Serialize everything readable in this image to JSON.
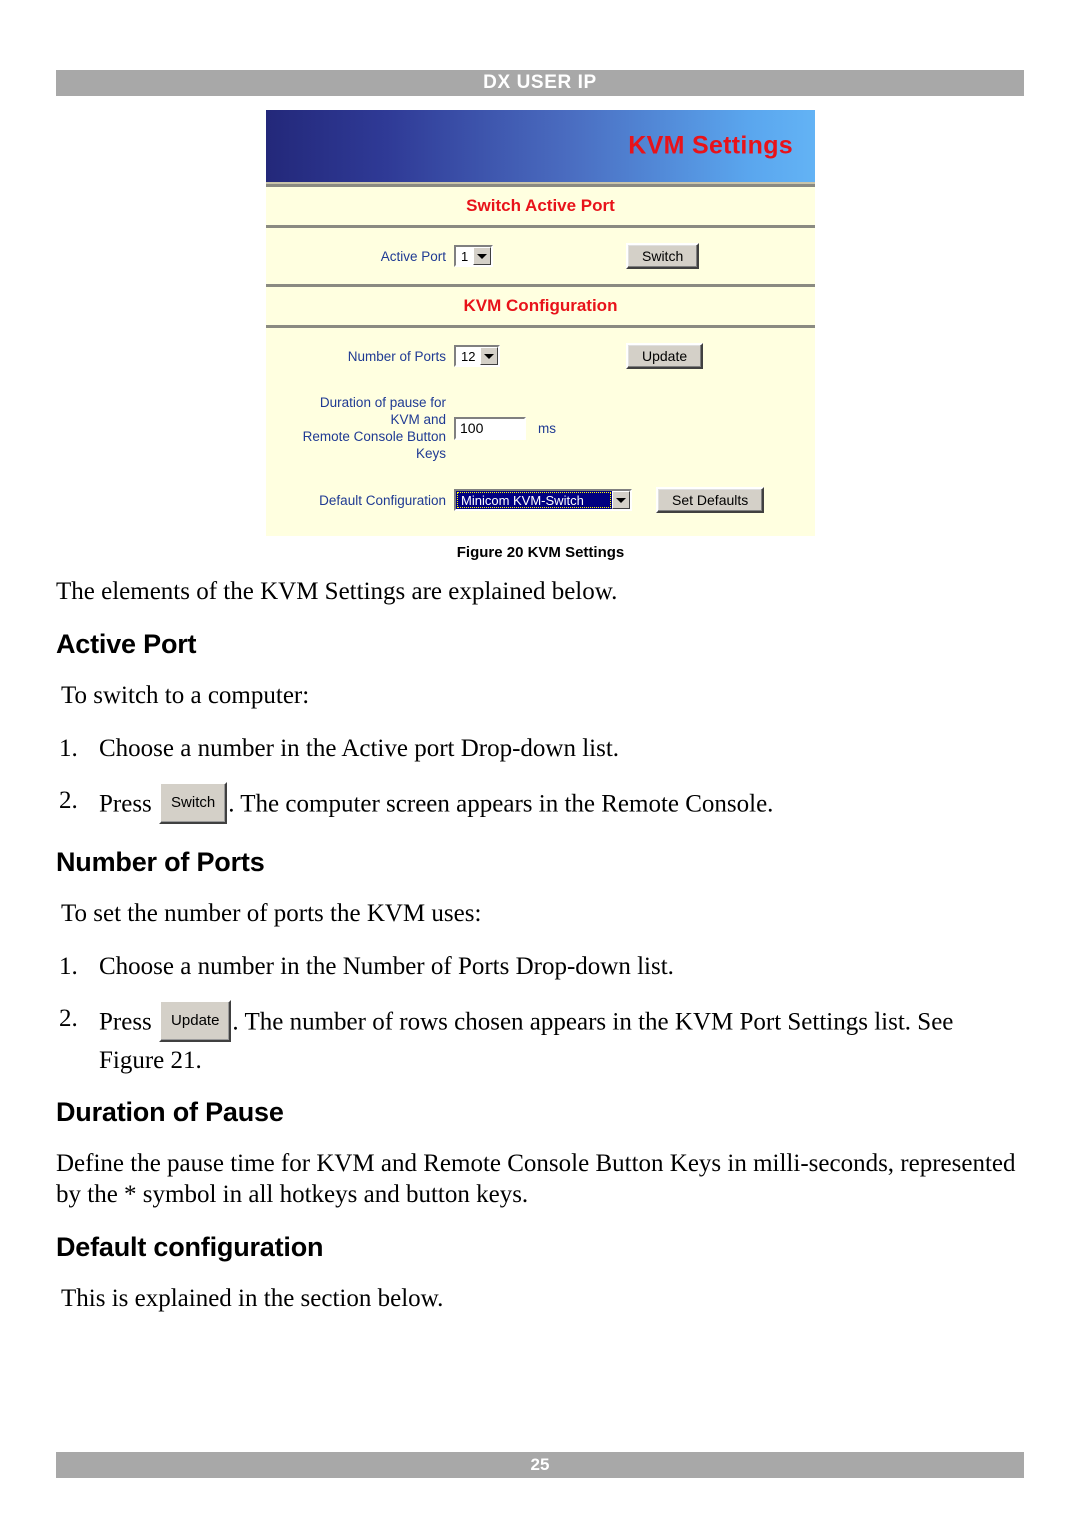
{
  "page": {
    "running_header": "DX USER IP",
    "page_number": "25"
  },
  "figure": {
    "caption": "Figure 20 KVM Settings",
    "banner_title": "KVM Settings",
    "colors": {
      "banner_gradient_start": "#23287a",
      "banner_gradient_end": "#63b3f5",
      "banner_title_color": "#e8131a",
      "panel_background": "#ffffe0",
      "label_color": "#1f3a93",
      "rule_color": "#8a8a82",
      "button_face": "#d4d0c8",
      "select_highlight": "#000080"
    },
    "sections": [
      {
        "heading": "Switch Active Port",
        "fields": [
          {
            "label": "Active Port",
            "control": "select",
            "value": "1",
            "button": "Switch"
          }
        ]
      },
      {
        "heading": "KVM Configuration",
        "fields": [
          {
            "label": "Number of Ports",
            "control": "select",
            "value": "12",
            "button": "Update"
          },
          {
            "label": "Duration of pause for KVM and Remote Console Button Keys",
            "label_lines": [
              "Duration of pause for",
              "KVM and",
              "Remote Console Button",
              "Keys"
            ],
            "control": "text",
            "value": "100",
            "unit": "ms",
            "button": ""
          },
          {
            "label": "Default Configuration",
            "control": "select",
            "value": "Minicom KVM-Switch",
            "selected": true,
            "button": "Set Defaults"
          }
        ]
      }
    ]
  },
  "body": {
    "intro": "The elements of the KVM Settings are explained below.",
    "sections": [
      {
        "heading": "Active Port",
        "lead": "To switch to a computer:",
        "steps": [
          {
            "num": "1.",
            "text_before": "Choose a number in the Active port Drop-down list.",
            "button": "",
            "text_after": ""
          },
          {
            "num": "2.",
            "text_before": "Press ",
            "button": "Switch",
            "text_after": ". The computer screen appears in the Remote Console."
          }
        ]
      },
      {
        "heading": "Number of Ports",
        "lead": "To set the number of ports the KVM uses:",
        "steps": [
          {
            "num": "1.",
            "text_before": "Choose a number in the Number of Ports Drop-down list.",
            "button": "",
            "text_after": ""
          },
          {
            "num": "2.",
            "text_before": "Press ",
            "button": "Update",
            "text_after": ". The number of rows chosen appears in the KVM Port Settings list. See Figure 21."
          }
        ]
      },
      {
        "heading": "Duration of Pause",
        "lead": "Define the pause time for KVM and Remote Console Button Keys in milli-seconds, represented by the * symbol in all hotkeys and button keys.",
        "steps": []
      },
      {
        "heading": "Default configuration",
        "lead": "This is explained in the section below.",
        "steps": []
      }
    ]
  }
}
